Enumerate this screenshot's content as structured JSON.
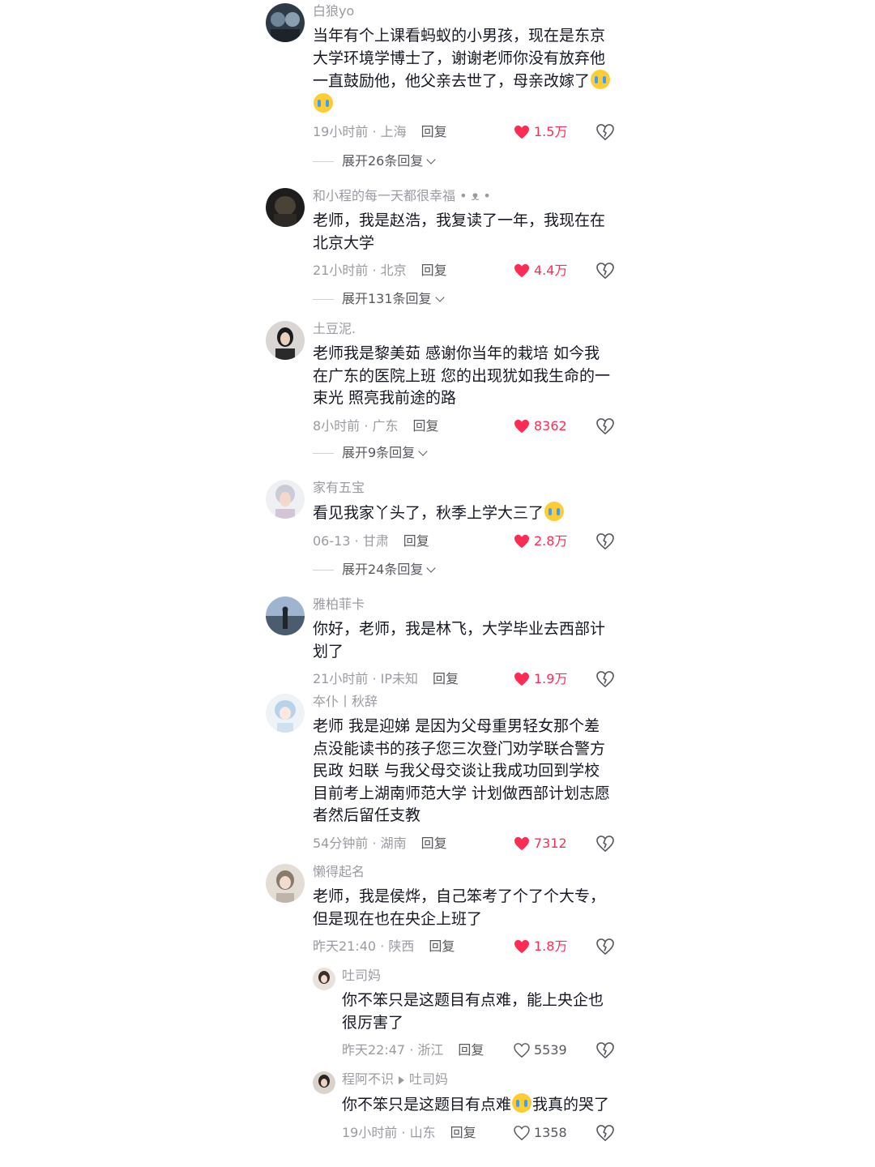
{
  "colors": {
    "like_active": "#fe2c55",
    "muted": "#9a9ba1",
    "text": "#161823"
  },
  "reply_label": "回复",
  "comments": [
    {
      "user": "白狼yo",
      "text": "当年有个上课看蚂蚁的小男孩，现在是东京大学环境学博士了，谢谢老师你没有放弃他一直鼓励他，他父亲去世了，母亲改嫁了",
      "emojis": [
        "crying-face",
        "crying-face"
      ],
      "time": "19小时前",
      "location": "上海",
      "likes": "1.5万",
      "liked": true,
      "expand": "展开26条回复"
    },
    {
      "user": "和小程的每一天都很幸福",
      "user_suffix": "• ᴥ •",
      "text": "老师，我是赵浩，我复读了一年，我现在在北京大学",
      "time": "21小时前",
      "location": "北京",
      "likes": "4.4万",
      "liked": true,
      "expand": "展开131条回复"
    },
    {
      "user": "土豆泥.",
      "text": "老师我是黎美茹 感谢你当年的栽培 如今我在广东的医院上班 您的出现犹如我生命的一束光 照亮我前途的路",
      "time": "8小时前",
      "location": "广东",
      "likes": "8362",
      "liked": true,
      "expand": "展开9条回复"
    },
    {
      "user": "家有五宝",
      "text": "看见我家丫头了，秋季上学大三了",
      "emojis": [
        "laughing-crying-face"
      ],
      "time": "06-13",
      "location": "甘肃",
      "likes": "2.8万",
      "liked": true,
      "expand": "展开24条回复"
    },
    {
      "user": "雅柏菲卡",
      "text": "你好，老师，我是林飞，大学毕业去西部计划了",
      "time": "21小时前",
      "location": "IP未知",
      "likes": "1.9万",
      "liked": true
    },
    {
      "user": "夲仆丨秋辞",
      "text": "老师 我是迎娣  是因为父母重男轻女那个差点没能读书的孩子您三次登门劝学联合警方民政 妇联 与我父母交谈让我成功回到学校目前考上湖南师范大学  计划做西部计划志愿者然后留任支教",
      "time": "54分钟前",
      "location": "湖南",
      "likes": "7312",
      "liked": true
    },
    {
      "user": "懒得起名",
      "text": "老师，我是侯烨，自己笨考了个了个大专，但是现在也在央企上班了",
      "time": "昨天21:40",
      "location": "陕西",
      "likes": "1.8万",
      "liked": true
    }
  ],
  "replies": [
    {
      "user": "吐司妈",
      "text": "你不笨只是这题目有点难，能上央企也很厉害了",
      "time": "昨天22:47",
      "location": "浙江",
      "likes": "5539",
      "liked": false
    },
    {
      "user": "程阿不识",
      "reply_to": "吐司妈",
      "text_before": "你不笨只是这题目有点难",
      "text_after": "我真的哭了",
      "emojis": [
        "crying-face"
      ],
      "time": "19小时前",
      "location": "山东",
      "likes": "1358",
      "liked": false
    }
  ]
}
